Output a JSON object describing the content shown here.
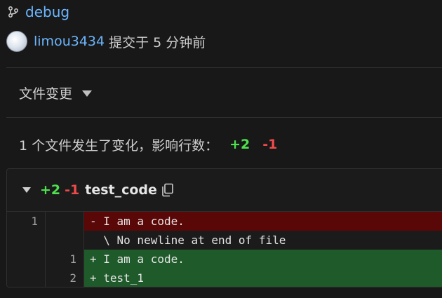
{
  "branch": {
    "name": "debug",
    "icon": "git-branch-icon"
  },
  "commit": {
    "user": "limou3434",
    "meta": "提交于 5 分钟前"
  },
  "changes": {
    "title": "文件变更"
  },
  "summary": {
    "text": "1 个文件发生了变化，影响行数：",
    "additions": "+2",
    "deletions": "-1"
  },
  "file": {
    "additions": "+2",
    "deletions": "-1",
    "name": "test_code",
    "diff": [
      {
        "type": "del",
        "old": "1",
        "new": "",
        "text": "- I am a code."
      },
      {
        "type": "ctx",
        "old": "",
        "new": "",
        "text": "  \\ No newline at end of file"
      },
      {
        "type": "add",
        "old": "",
        "new": "1",
        "text": "+ I am a code."
      },
      {
        "type": "add",
        "old": "",
        "new": "2",
        "text": "+ test_1"
      }
    ]
  },
  "colors": {
    "link": "#6cb6ff",
    "add": "#4ee24e",
    "del": "#ef4a4a",
    "del_bg": "#5a0707",
    "add_bg": "#1f5a2a"
  }
}
